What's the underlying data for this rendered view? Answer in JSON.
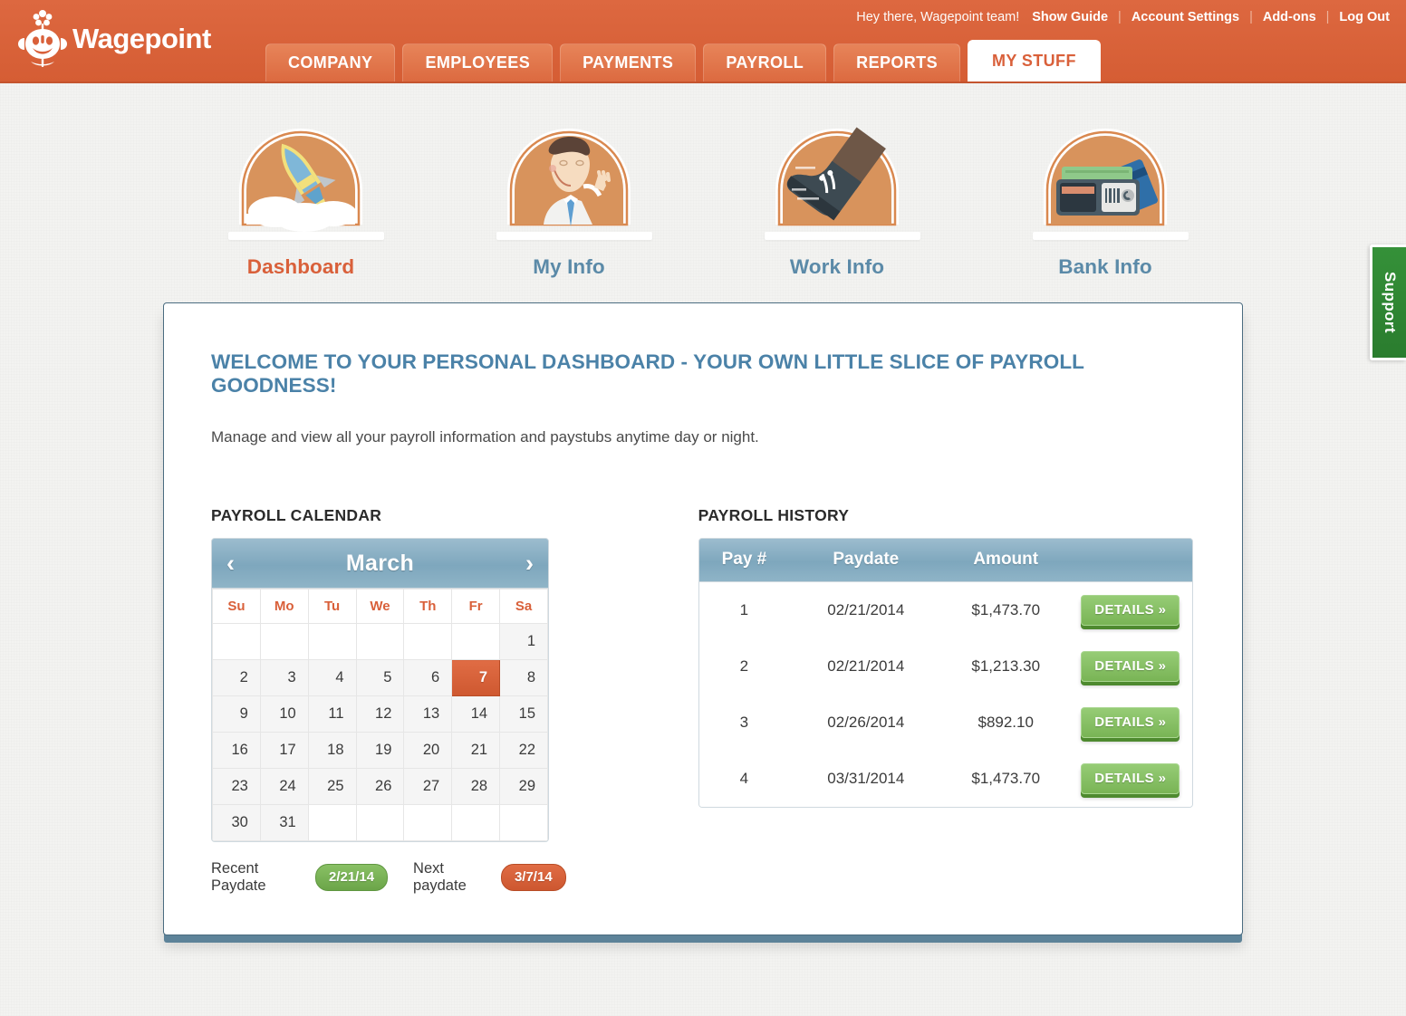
{
  "brand": {
    "name": "Wagepoint",
    "logo_icon": "wagepoint-flower-face-logo"
  },
  "header": {
    "greeting": "Hey there, Wagepoint team!",
    "util_links": [
      {
        "label": "Show Guide",
        "name": "show-guide"
      },
      {
        "label": "Account Settings",
        "name": "account-settings"
      },
      {
        "label": "Add-ons",
        "name": "add-ons"
      },
      {
        "label": "Log Out",
        "name": "log-out"
      }
    ],
    "separator": "|",
    "tabs": [
      {
        "label": "COMPANY",
        "active": false
      },
      {
        "label": "EMPLOYEES",
        "active": false
      },
      {
        "label": "PAYMENTS",
        "active": false
      },
      {
        "label": "PAYROLL",
        "active": false
      },
      {
        "label": "REPORTS",
        "active": false
      },
      {
        "label": "MY STUFF",
        "active": true
      }
    ],
    "accent_color": "#d9603a"
  },
  "icon_nav": [
    {
      "label": "Dashboard",
      "icon": "rocket-icon",
      "active": true
    },
    {
      "label": "My Info",
      "icon": "person-waving-icon",
      "active": false
    },
    {
      "label": "Work Info",
      "icon": "boot-icon",
      "active": false
    },
    {
      "label": "Bank Info",
      "icon": "wallet-cards-icon",
      "active": false
    }
  ],
  "main": {
    "welcome_title": "WELCOME TO YOUR PERSONAL DASHBOARD - YOUR OWN LITTLE SLICE OF PAYROLL GOODNESS!",
    "welcome_subtitle": "Manage and view all your payroll information and paystubs anytime day or night.",
    "title_color": "#4b82a8"
  },
  "calendar": {
    "section_title": "PAYROLL CALENDAR",
    "prev_icon": "‹",
    "next_icon": "›",
    "month": "March",
    "weekdays": [
      "Su",
      "Mo",
      "Tu",
      "We",
      "Th",
      "Fr",
      "Sa"
    ],
    "weeks": [
      [
        "",
        "",
        "",
        "",
        "",
        "",
        "1"
      ],
      [
        "2",
        "3",
        "4",
        "5",
        "6",
        "7",
        "8"
      ],
      [
        "9",
        "10",
        "11",
        "12",
        "13",
        "14",
        "15"
      ],
      [
        "16",
        "17",
        "18",
        "19",
        "20",
        "21",
        "22"
      ],
      [
        "23",
        "24",
        "25",
        "26",
        "27",
        "28",
        "29"
      ],
      [
        "30",
        "31",
        "",
        "",
        "",
        "",
        ""
      ]
    ],
    "highlighted_day": "7",
    "recent_paydate_label": "Recent Paydate",
    "recent_paydate_value": "2/21/14",
    "next_paydate_label": "Next paydate",
    "next_paydate_value": "3/7/14",
    "recent_badge_color": "#76b154",
    "next_badge_color": "#d9603a"
  },
  "history": {
    "section_title": "PAYROLL HISTORY",
    "columns": [
      "Pay #",
      "Paydate",
      "Amount",
      ""
    ],
    "rows": [
      {
        "pay_no": "1",
        "paydate": "02/21/2014",
        "amount": "$1,473.70",
        "action": "DETAILS »"
      },
      {
        "pay_no": "2",
        "paydate": "02/21/2014",
        "amount": "$1,213.30",
        "action": "DETAILS »"
      },
      {
        "pay_no": "3",
        "paydate": "02/26/2014",
        "amount": "$892.10",
        "action": "DETAILS »"
      },
      {
        "pay_no": "4",
        "paydate": "03/31/2014",
        "amount": "$1,473.70",
        "action": "DETAILS »"
      }
    ],
    "button_color": "#85c063"
  },
  "support": {
    "label": "Support",
    "color": "#2f8733"
  }
}
